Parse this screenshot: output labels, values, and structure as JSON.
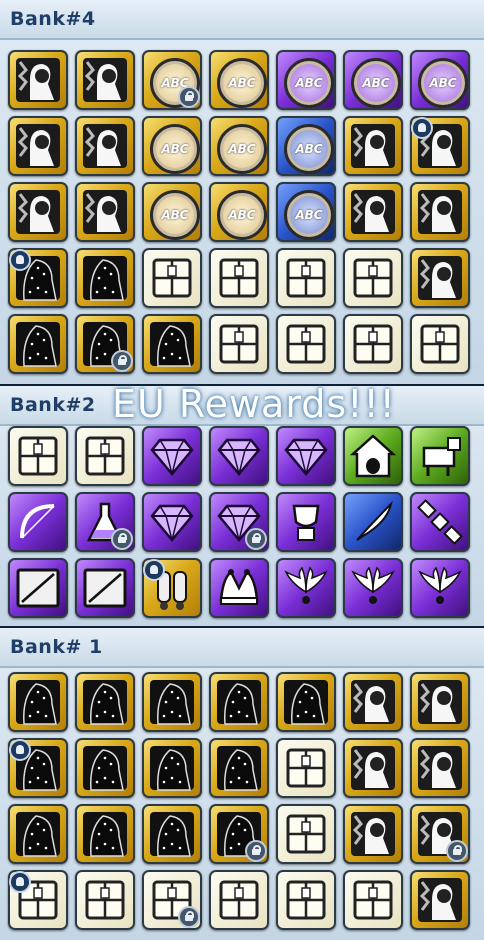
{
  "overlay_text": "EU Rewards!!!",
  "banks": [
    {
      "title": "Bank#4",
      "rows": [
        [
          "costume-icon",
          "costume-icon",
          "abc-token-gold-icon",
          "abc-token-gold-icon",
          "abc-token-purple-icon",
          "abc-token-purple-icon",
          "abc-token-purple-icon"
        ],
        [
          "costume-icon",
          "costume-icon",
          "abc-token-gold-icon",
          "abc-token-gold-icon",
          "abc-token-blue-icon",
          "costume-icon",
          "costume-icon"
        ],
        [
          "costume-icon",
          "costume-icon",
          "abc-token-gold-icon",
          "abc-token-gold-icon",
          "abc-token-blue-icon",
          "costume-icon",
          "costume-icon"
        ],
        [
          "cloak-icon",
          "cloak-icon",
          "crate-icon",
          "crate-icon",
          "crate-icon",
          "crate-icon",
          "costume-icon"
        ],
        [
          "cloak-icon",
          "cloak-icon",
          "cloak-icon",
          "crate-icon",
          "crate-icon",
          "crate-icon",
          "crate-icon"
        ]
      ]
    },
    {
      "title": "Bank#2",
      "rows": [
        [
          "crate-icon",
          "crate-icon",
          "gem-icon",
          "gem-icon",
          "gem-icon",
          "doghouse-icon",
          "robot-pet-icon"
        ],
        [
          "bow-icon",
          "potion-flask-icon",
          "gem-icon",
          "gem-icon",
          "trophy-icon",
          "quill-icon",
          "satellite-icon"
        ],
        [
          "crate-shield-icon",
          "crate-shield-icon",
          "jetpack-icon",
          "jester-hat-icon",
          "wings-icon",
          "wings-icon",
          "wings-icon"
        ]
      ]
    },
    {
      "title": "Bank# 1",
      "rows": [
        [
          "cloak-icon",
          "cloak-icon",
          "cloak-icon",
          "cloak-icon",
          "cloak-icon",
          "costume-icon",
          "costume-icon"
        ],
        [
          "cloak-icon",
          "cloak-icon",
          "cloak-icon",
          "cloak-icon",
          "crate-icon",
          "costume-icon",
          "costume-icon"
        ],
        [
          "cloak-icon",
          "cloak-icon",
          "cloak-icon",
          "cloak-icon",
          "crate-icon",
          "costume-icon",
          "costume-icon"
        ],
        [
          "crate-icon",
          "crate-icon",
          "crate-icon",
          "crate-icon",
          "crate-icon",
          "crate-icon",
          "costume-icon"
        ]
      ]
    }
  ],
  "colors": {
    "header_text": "#1f3f68",
    "gold": "#d9a91a",
    "purple": "#7a2fd6",
    "blue": "#2a54c8",
    "green": "#5caa1e"
  }
}
